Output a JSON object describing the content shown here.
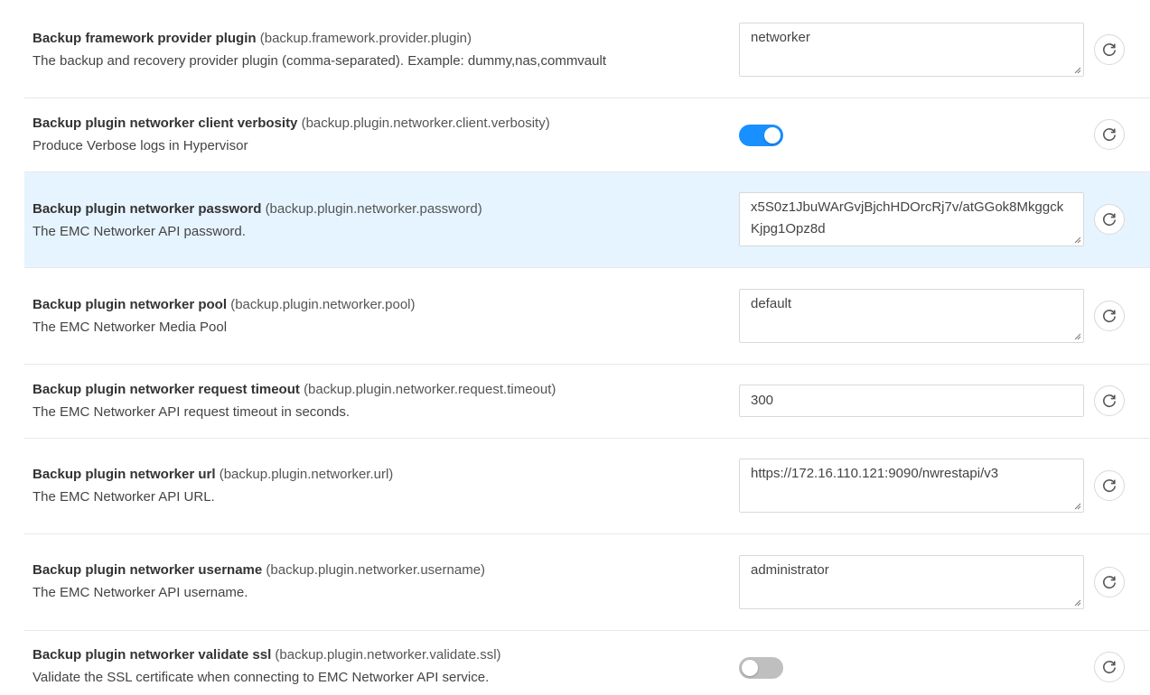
{
  "settings": [
    {
      "title": "Backup framework provider plugin",
      "key": "(backup.framework.provider.plugin)",
      "description": "The backup and recovery provider plugin (comma-separated). Example: dummy,nas,commvault",
      "control": "textarea",
      "value": "networker"
    },
    {
      "title": "Backup plugin networker client verbosity",
      "key": "(backup.plugin.networker.client.verbosity)",
      "description": "Produce Verbose logs in Hypervisor",
      "control": "toggle",
      "value": "on"
    },
    {
      "title": "Backup plugin networker password",
      "key": "(backup.plugin.networker.password)",
      "description": "The EMC Networker API password.",
      "control": "textarea",
      "value": "x5S0z1JbuWArGvjBjchHDOrcRj7v/atGGok8MkggckKjpg1Opz8d",
      "highlighted": true
    },
    {
      "title": "Backup plugin networker pool",
      "key": "(backup.plugin.networker.pool)",
      "description": "The EMC Networker Media Pool",
      "control": "textarea",
      "value": "default"
    },
    {
      "title": "Backup plugin networker request timeout",
      "key": "(backup.plugin.networker.request.timeout)",
      "description": "The EMC Networker API request timeout in seconds.",
      "control": "input",
      "value": "300"
    },
    {
      "title": "Backup plugin networker url",
      "key": "(backup.plugin.networker.url)",
      "description": "The EMC Networker API URL.",
      "control": "textarea",
      "value": "https://172.16.110.121:9090/nwrestapi/v3"
    },
    {
      "title": "Backup plugin networker username",
      "key": "(backup.plugin.networker.username)",
      "description": "The EMC Networker API username.",
      "control": "textarea",
      "value": "administrator"
    },
    {
      "title": "Backup plugin networker validate ssl",
      "key": "(backup.plugin.networker.validate.ssl)",
      "description": "Validate the SSL certificate when connecting to EMC Networker API service.",
      "control": "toggle",
      "value": "off"
    }
  ],
  "icons": {
    "reset": "reset-icon",
    "resize": "resize-grip-icon"
  },
  "colors": {
    "highlight_row": "#e6f4ff",
    "toggle_on": "#1890ff",
    "toggle_off": "#bfbfbf"
  }
}
